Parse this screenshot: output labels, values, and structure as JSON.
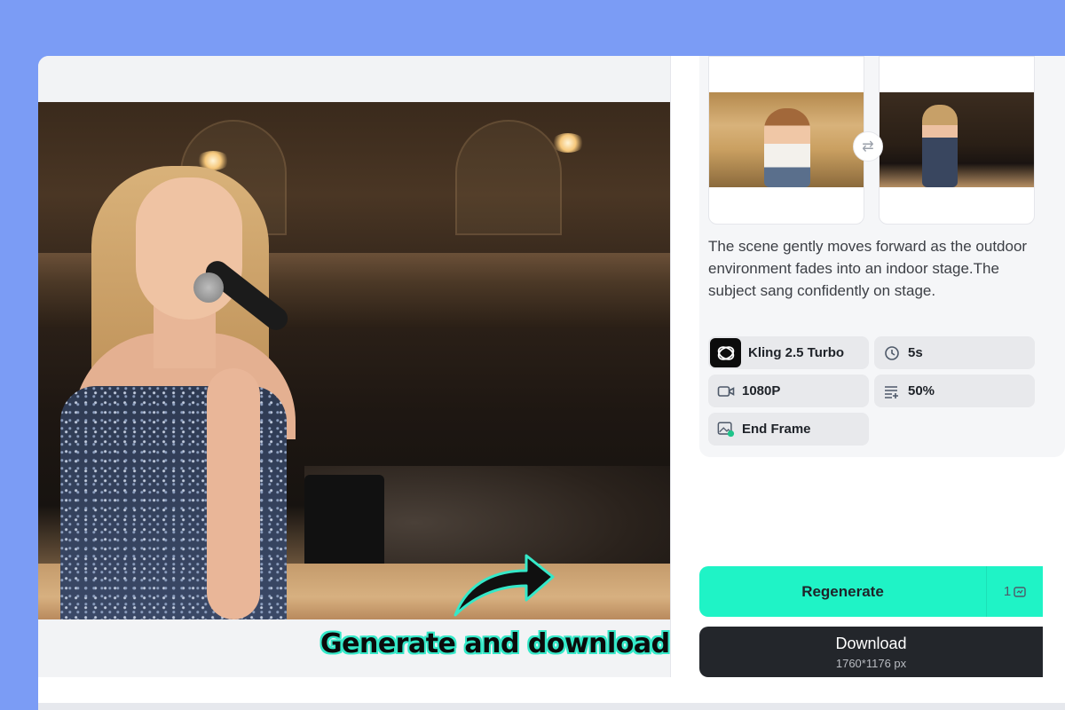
{
  "preview": {
    "promo_caption": "Generate and download"
  },
  "frames": {
    "start_alt": "Start frame: girl in wheat field",
    "end_alt": "End frame: girl singing on stage"
  },
  "prompt": {
    "text": "The scene gently moves forward as the outdoor environment fades into an indoor stage.The subject sang confidently on stage."
  },
  "settings": {
    "model": "Kling 2.5 Turbo",
    "duration": "5s",
    "resolution": "1080P",
    "strength": "50%",
    "frame_mode": "End Frame"
  },
  "actions": {
    "regenerate_label": "Regenerate",
    "regenerate_credits": "1",
    "download_label": "Download",
    "download_size": "1760*1176 px"
  },
  "colors": {
    "background": "#7b9cf5",
    "accent": "#1ff3c6",
    "download_bg": "#23262b"
  }
}
